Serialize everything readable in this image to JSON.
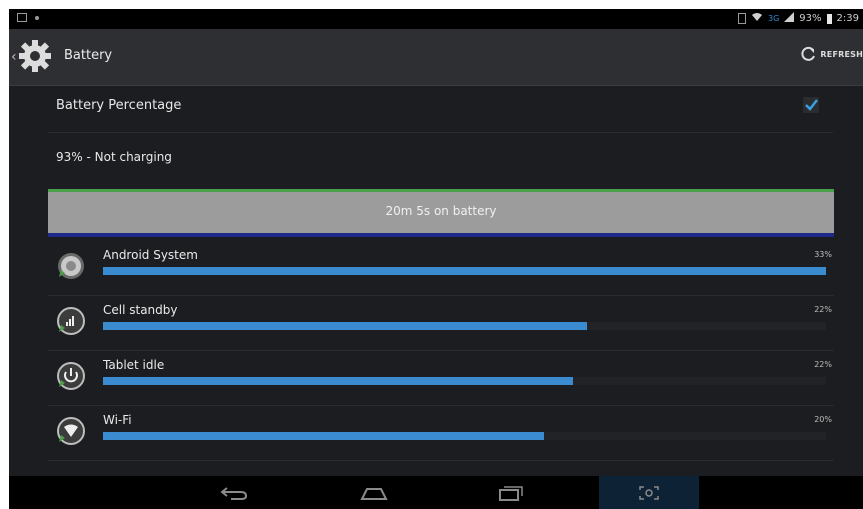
{
  "status_bar": {
    "battery_percent": "93%",
    "time": "2:39",
    "network": "3G"
  },
  "action_bar": {
    "title": "Battery",
    "refresh_label": "REFRESH"
  },
  "preferences": {
    "battery_percentage_label": "Battery Percentage",
    "battery_percentage_checked": true,
    "status_text": "93% - Not charging"
  },
  "graph": {
    "label": "20m 5s on battery"
  },
  "usage_list": [
    {
      "name": "Android System",
      "percent_label": "33%",
      "fraction": 1.0
    },
    {
      "name": "Cell standby",
      "percent_label": "22%",
      "fraction": 0.67
    },
    {
      "name": "Tablet idle",
      "percent_label": "22%",
      "fraction": 0.65
    },
    {
      "name": "Wi-Fi",
      "percent_label": "20%",
      "fraction": 0.61
    }
  ],
  "colors": {
    "bar_fill": "#3a8bd0",
    "graph_top": "#4aa04a",
    "graph_bottom": "#1d2a8a",
    "active_nav": "#0d2234"
  },
  "icons": {
    "usage": [
      "android-system-icon",
      "cell-standby-icon",
      "tablet-idle-icon",
      "wifi-icon"
    ],
    "nav": [
      "back-icon",
      "home-icon",
      "recent-apps-icon",
      "screenshot-icon"
    ]
  }
}
